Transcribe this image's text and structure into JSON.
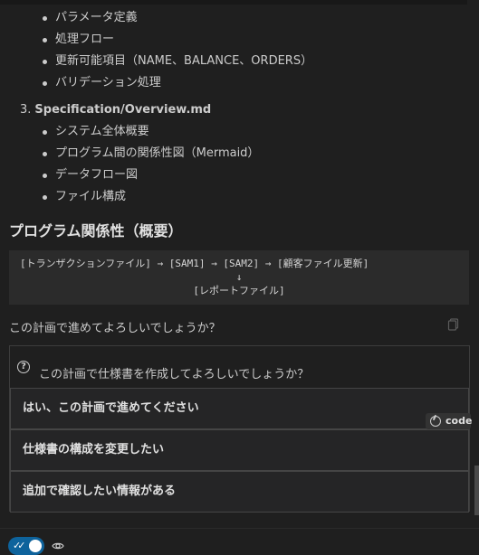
{
  "list_a": [
    {
      "label": "パラメータ定義"
    },
    {
      "label": "処理フロー"
    },
    {
      "label": "更新可能項目（NAME、BALANCE、ORDERS）"
    },
    {
      "label": "バリデーション処理"
    }
  ],
  "numbered_item": {
    "number": "3.",
    "label": "Specification/Overview.md"
  },
  "list_b": [
    {
      "label": "システム全体概要"
    },
    {
      "label": "プログラム間の関係性図（Mermaid）"
    },
    {
      "label": "データフロー図"
    },
    {
      "label": "ファイル構成"
    }
  ],
  "section_title": "プログラム関係性（概要）",
  "code_block": {
    "line1": "[トランザクションファイル] → [SAM1] → [SAM2] → [顧客ファイル更新]",
    "line2": "↓",
    "line3": "[レポートファイル]"
  },
  "question": "この計画で進めてよろしいでしょうか？",
  "panel": {
    "title": "この計画で仕様書を作成してよろしいでしょうか？",
    "options": [
      {
        "label": "はい、この計画で進めてください"
      },
      {
        "label": "仕様書の構成を変更したい"
      },
      {
        "label": "追加で確認したい情報がある"
      }
    ]
  },
  "code_badge": "code",
  "colors": {
    "accent": "#0e639c",
    "background": "#1f1f1f"
  }
}
